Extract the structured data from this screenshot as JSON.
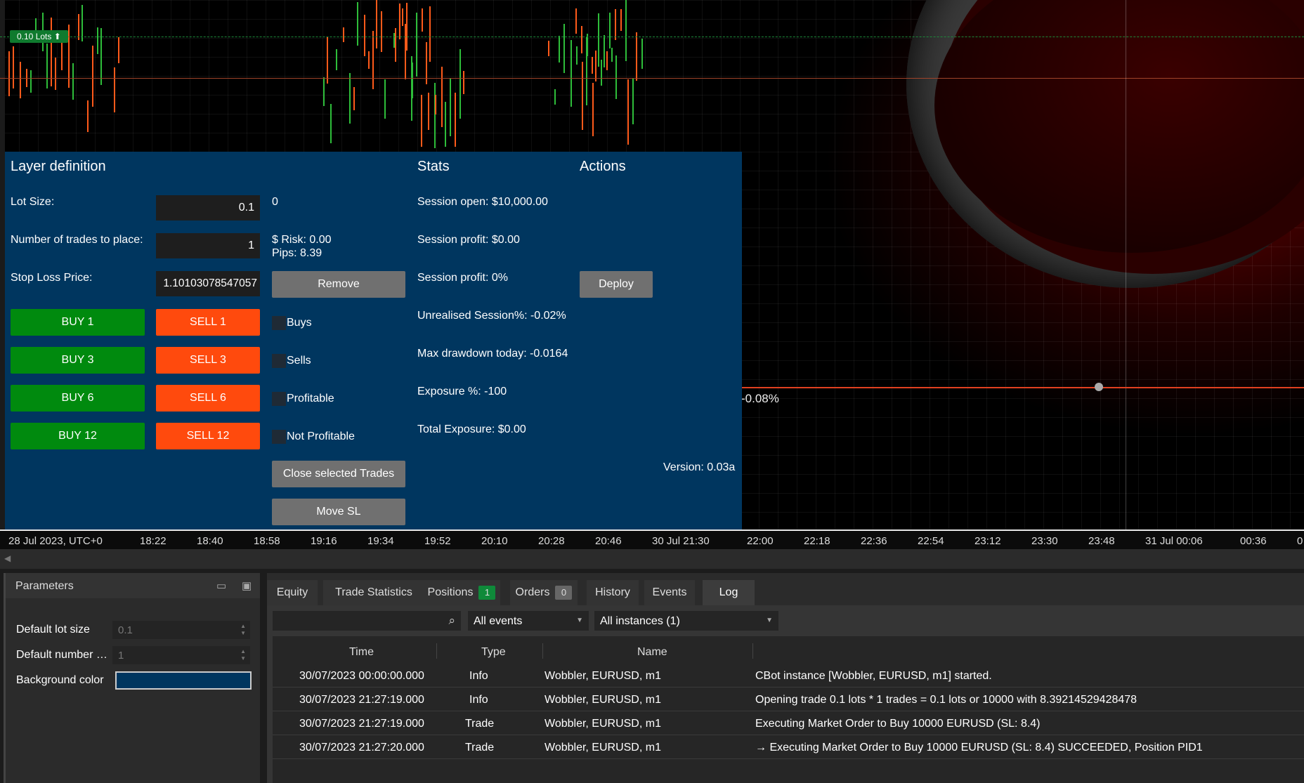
{
  "chart": {
    "lots_badge": "0.10 Lots ⬆",
    "pct_label": "-0.08%",
    "timeline": [
      "28 Jul 2023, UTC+0",
      "18:22",
      "18:40",
      "18:58",
      "19:16",
      "19:34",
      "19:52",
      "20:10",
      "20:28",
      "20:46",
      "30 Jul 21:30",
      "22:00",
      "22:18",
      "22:36",
      "22:54",
      "23:12",
      "23:30",
      "23:48",
      "31 Jul 00:06",
      "00:36",
      "0"
    ]
  },
  "panel": {
    "headings": {
      "layer": "Layer definition",
      "stats": "Stats",
      "actions": "Actions"
    },
    "labels": {
      "lot_size": "Lot Size:",
      "num_trades": "Number of trades to place:",
      "stop_loss": "Stop Loss Price:"
    },
    "inputs": {
      "lot_size": "0.1",
      "num_trades": "1",
      "stop_loss": "1.10103078547057"
    },
    "info": {
      "zero": "0",
      "risk": "$ Risk: 0.00",
      "pips": "Pips: 8.39"
    },
    "buttons": {
      "remove": "Remove",
      "deploy": "Deploy",
      "close_selected": "Close selected Trades",
      "move_sl": "Move SL",
      "buy": [
        "BUY 1",
        "BUY 3",
        "BUY 6",
        "BUY 12"
      ],
      "sell": [
        "SELL 1",
        "SELL 3",
        "SELL 6",
        "SELL 12"
      ]
    },
    "filters": [
      "Buys",
      "Sells",
      "Profitable",
      "Not Profitable"
    ],
    "stats": [
      "Session open: $10,000.00",
      "Session profit: $0.00",
      "Session profit: 0%",
      "Unrealised Session%: -0.02%",
      "Max drawdown today: -0.0164",
      "Exposure %: -100",
      "Total Exposure: $0.00"
    ],
    "version": "Version: 0.03a"
  },
  "parameters": {
    "title": "Parameters",
    "items": [
      {
        "label": "Default lot size",
        "value": "0.1"
      },
      {
        "label": "Default number of trades",
        "value": "1"
      },
      {
        "label": "Background color"
      }
    ]
  },
  "tabs": [
    {
      "label": "Equity"
    },
    {
      "label": "Trade Statistics"
    },
    {
      "label": "Positions",
      "badge": "1"
    },
    {
      "label": "Orders",
      "badge": "0"
    },
    {
      "label": "History"
    },
    {
      "label": "Events"
    },
    {
      "label": "Log"
    }
  ],
  "log": {
    "search_placeholder": "",
    "event_filter": "All events",
    "instance_filter": "All instances (1)",
    "columns": [
      "Time",
      "Type",
      "Name"
    ],
    "rows": [
      {
        "time": "30/07/2023 00:00:00.000",
        "type": "Info",
        "name": "Wobbler, EURUSD, m1",
        "message": "CBot instance [Wobbler, EURUSD, m1] started."
      },
      {
        "time": "30/07/2023 21:27:19.000",
        "type": "Info",
        "name": "Wobbler, EURUSD, m1",
        "message": "Opening trade 0.1 lots * 1 trades = 0.1 lots or 10000  with 8.39214529428478"
      },
      {
        "time": "30/07/2023 21:27:19.000",
        "type": "Trade",
        "name": "Wobbler, EURUSD, m1",
        "message": "Executing Market Order to Buy 10000 EURUSD (SL: 8.4)"
      },
      {
        "time": "30/07/2023 21:27:20.000",
        "type": "Trade",
        "name": "Wobbler, EURUSD, m1",
        "message": "→ Executing Market Order to Buy 10000 EURUSD (SL: 8.4) SUCCEEDED, Position PID1"
      }
    ]
  },
  "colors": {
    "panel_bg": "#00365f",
    "buy": "#008a0e",
    "sell": "#ff4a0d",
    "badge_green": "#0f8a3a",
    "badge_grey": "#666666"
  }
}
